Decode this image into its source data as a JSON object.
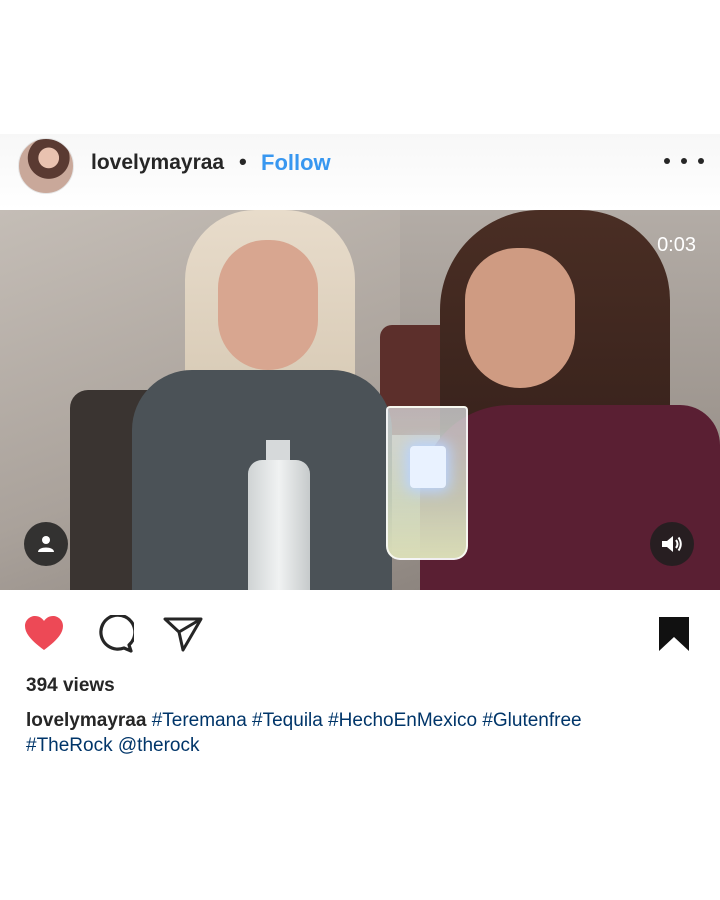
{
  "post": {
    "username": "lovelymayraa",
    "separator": "•",
    "follow_label": "Follow",
    "video_timer": "0:03",
    "views": "394 views",
    "caption": {
      "username": "lovelymayraa",
      "tags": [
        "#Teremana",
        "#Tequila",
        "#HechoEnMexico",
        "#Glutenfree",
        "#TheRock",
        "@therock"
      ]
    },
    "liked": true
  },
  "colors": {
    "accent": "#3897f0",
    "like": "#ed4956",
    "hashtag": "#003569",
    "text": "#262626"
  },
  "icons": {
    "more": "more-options-icon",
    "user_tag": "user-tag-icon",
    "sound": "speaker-icon",
    "like": "heart-icon",
    "comment": "comment-icon",
    "share": "share-icon",
    "save": "bookmark-icon"
  }
}
